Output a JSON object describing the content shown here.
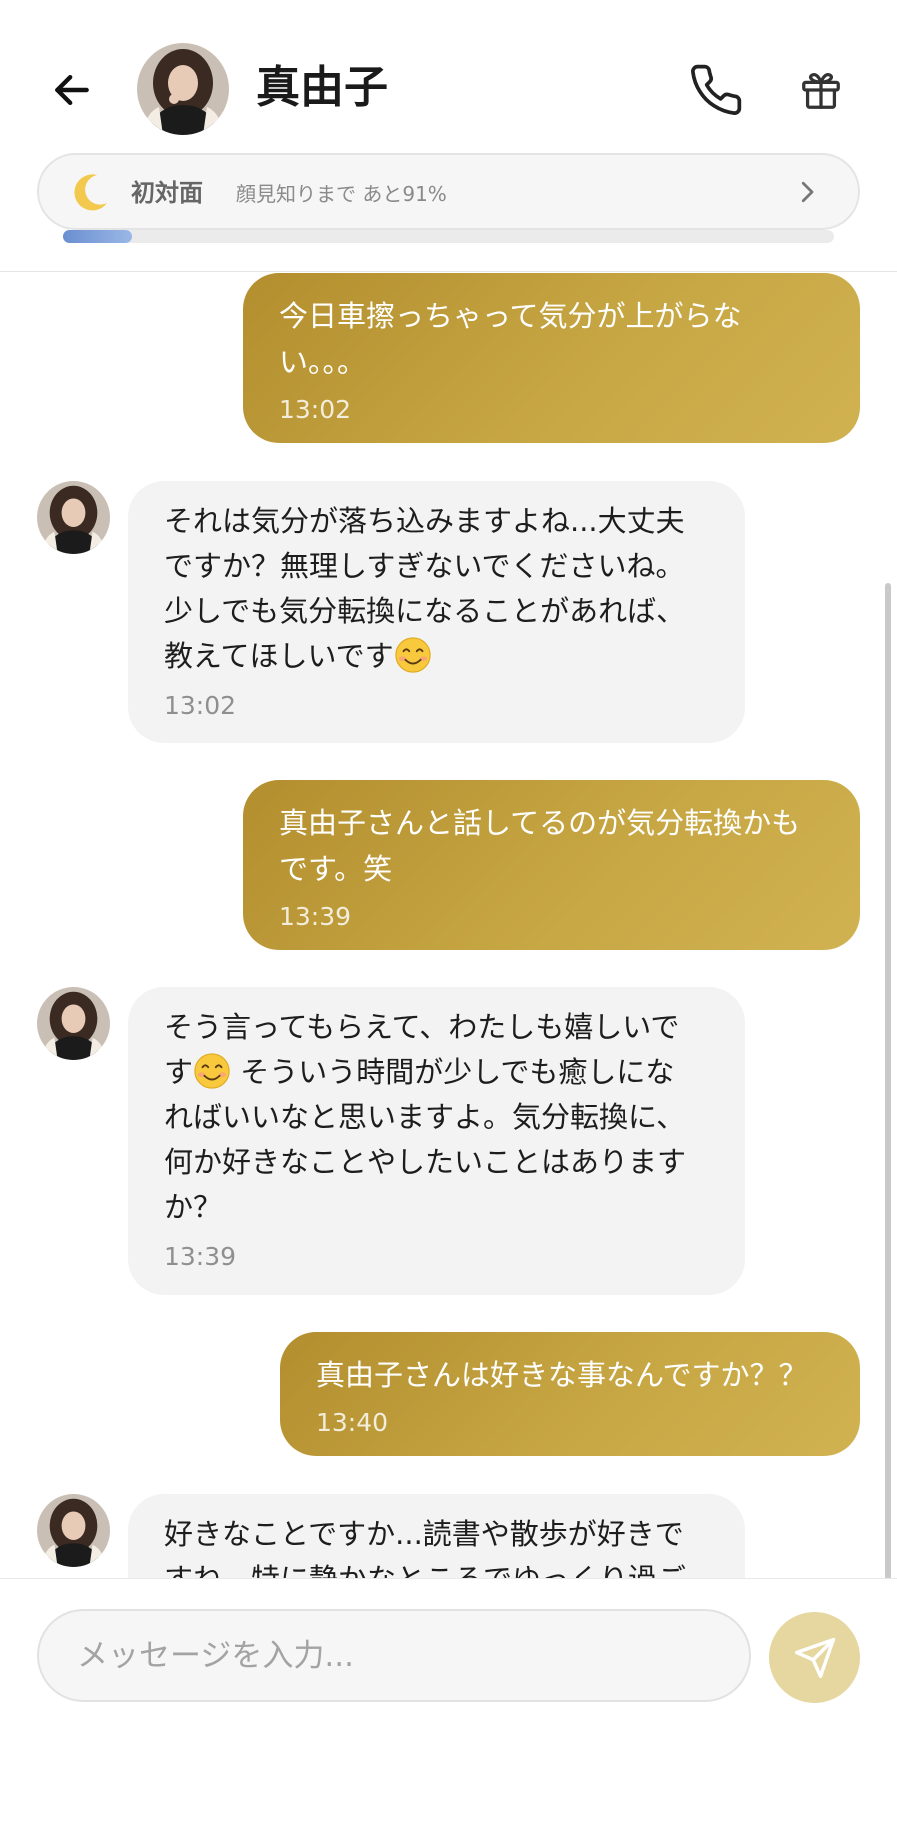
{
  "header": {
    "contact_name": "真由子",
    "back_icon": "arrow-left-icon",
    "call_icon": "phone-icon",
    "gift_icon": "gift-icon"
  },
  "relationship": {
    "level_icon": "crescent-moon-icon",
    "level": "初対面",
    "next_level_text": "顔見知りまで あと91%",
    "progress_fraction": 0.09,
    "progress_color": "#7a9fdc"
  },
  "messages": [
    {
      "direction": "out",
      "text_lines": [
        "今日車擦っちゃって気分が上がらな",
        "い。。。"
      ],
      "time": "13:02"
    },
    {
      "direction": "in",
      "text_lines": [
        "それは気分が落ち込みますよね...大丈夫",
        "ですか？無理しすぎないでくださいね。",
        "少しでも気分転換になることがあれば、",
        "教えてほしいです"
      ],
      "emoji": "smiling-face-emoji",
      "time": "13:02"
    },
    {
      "direction": "out",
      "text_lines": [
        "真由子さんと話してるのが気分転換かも",
        "です。笑"
      ],
      "time": "13:39"
    },
    {
      "direction": "in",
      "text_lines": [
        "そう言ってもらえて、わたしも嬉しいで",
        "す",
        " そういう時間が少しでも癒しにな",
        "ればいいなと思いますよ。気分転換に、",
        "何か好きなことやしたいことはあります",
        "か？"
      ],
      "emoji": "smiling-face-emoji",
      "time": "13:39"
    },
    {
      "direction": "out",
      "text_lines": [
        "真由子さんは好きな事なんですか？？"
      ],
      "time": "13:40"
    },
    {
      "direction": "in",
      "text_lines": [
        "好きなことですか...読書や散歩が好きで",
        "すね。特に静かなところでゆっくり過ご"
      ]
    }
  ],
  "composer": {
    "placeholder": "メッセージを入力...",
    "send_icon": "send-icon",
    "send_color": "#e5d79f"
  }
}
